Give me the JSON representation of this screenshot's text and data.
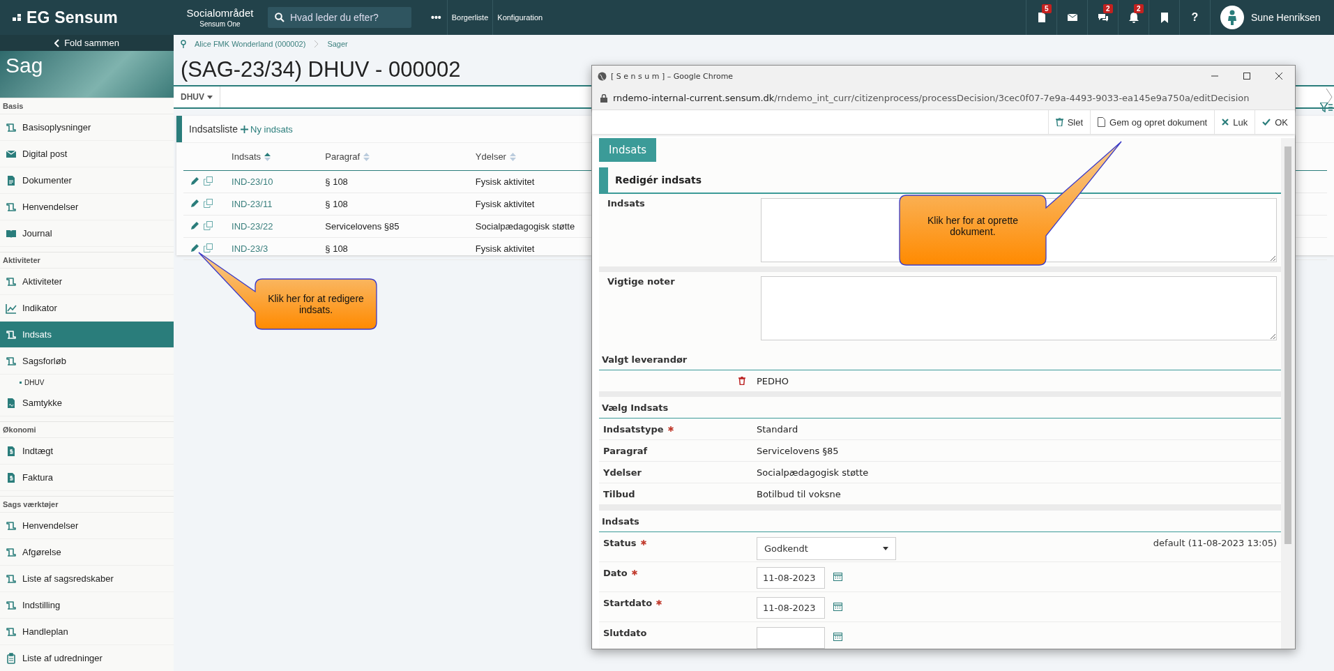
{
  "topbar": {
    "logo": "EG Sensum",
    "area": "Socialområdet",
    "product": "Sensum One",
    "search": {
      "placeholder": "Hvad leder du efter?"
    },
    "more": "•••",
    "links": [
      "Borgerliste",
      "Konfiguration"
    ],
    "icons": [
      {
        "kind": "document",
        "badge": "5"
      },
      {
        "kind": "mail"
      },
      {
        "kind": "chat",
        "badge": "2"
      },
      {
        "kind": "bell",
        "badge": "2"
      },
      {
        "kind": "bookmark"
      },
      {
        "kind": "help",
        "label": "?"
      }
    ],
    "user": "Sune Henriksen"
  },
  "sidebar": {
    "collapse": "Fold sammen",
    "title": "Sag",
    "sections": [
      {
        "heading": "Basis",
        "items": [
          {
            "label": "Basisoplysninger",
            "kind": "scroll",
            "selected": false
          },
          {
            "label": "Digital post",
            "kind": "mail",
            "selected": false
          },
          {
            "label": "Dokumenter",
            "kind": "document",
            "selected": false
          },
          {
            "label": "Henvendelser",
            "kind": "scroll",
            "selected": false
          },
          {
            "label": "Journal",
            "kind": "book",
            "selected": false
          }
        ]
      },
      {
        "heading": "Aktiviteter",
        "items": [
          {
            "label": "Aktiviteter",
            "kind": "scroll",
            "selected": false
          },
          {
            "label": "Indikator",
            "kind": "chart",
            "selected": false
          },
          {
            "label": "Indsats",
            "kind": "scroll",
            "selected": true
          },
          {
            "label": "Sagsforløb",
            "kind": "scroll",
            "selected": false,
            "children": [
              {
                "label": "DHUV",
                "selected": false
              }
            ]
          },
          {
            "label": "Samtykke",
            "kind": "signed",
            "selected": false
          }
        ]
      },
      {
        "heading": "Økonomi",
        "items": [
          {
            "label": "Indtægt",
            "kind": "money",
            "selected": false
          },
          {
            "label": "Faktura",
            "kind": "money",
            "selected": false
          }
        ]
      },
      {
        "heading": "Sags værktøjer",
        "items": [
          {
            "label": "Henvendelser",
            "kind": "scroll",
            "selected": false
          },
          {
            "label": "Afgørelse",
            "kind": "scroll",
            "selected": false
          },
          {
            "label": "Liste af sagsredskaber",
            "kind": "scroll",
            "selected": false
          },
          {
            "label": "Indstilling",
            "kind": "scroll",
            "selected": false
          },
          {
            "label": "Handleplan",
            "kind": "scroll",
            "selected": false
          },
          {
            "label": "Liste af udredninger",
            "kind": "clipboard",
            "selected": false
          }
        ]
      }
    ]
  },
  "main": {
    "breadcrumb": [
      "Alice FMK Wonderland (000002)",
      "Sager"
    ],
    "title": "(SAG-23/34) DHUV - 000002",
    "case_tab": {
      "label": "DHUV"
    },
    "panel": {
      "title": "Indsatsliste",
      "action": "Ny indsats",
      "columns": [
        {
          "label": "Indsats",
          "sorted": true
        },
        {
          "label": "Paragraf",
          "sorted": false
        },
        {
          "label": "Ydelser",
          "sorted": false
        }
      ],
      "rows": [
        [
          "IND-23/10",
          "§ 108",
          "Fysisk aktivitet"
        ],
        [
          "IND-23/11",
          "§ 108",
          "Fysisk aktivitet"
        ],
        [
          "IND-23/22",
          "Servicelovens §85",
          "Socialpædagogisk støtte"
        ],
        [
          "IND-23/3",
          "§ 108",
          "Fysisk aktivitet"
        ]
      ]
    }
  },
  "popup": {
    "window_title": "[ S e n s u m ] – Google Chrome",
    "url": {
      "host": "rndemo-internal-current.sensum.dk",
      "path": "/rndemo_int_curr/citizenprocess/processDecision/3cec0f07-7e9a-4493-9033-ea145e9a750a/editDecision"
    },
    "toolbar": [
      {
        "kind": "delete",
        "label": "Slet"
      },
      {
        "kind": "document",
        "label": "Gem og opret dokument"
      },
      {
        "kind": "close",
        "label": "Luk"
      },
      {
        "kind": "ok",
        "label": "OK"
      }
    ],
    "tab": "Indsats",
    "section_title": "Redigér indsats",
    "text_areas": [
      {
        "label": "Indsats"
      },
      {
        "label": "Vigtige noter"
      }
    ],
    "supplier": {
      "heading": "Valgt leverandør",
      "value": "PEDHO"
    },
    "choice": {
      "heading": "Vælg Indsats",
      "rows": [
        {
          "label": "Indsatstype",
          "required": true,
          "value": "Standard"
        },
        {
          "label": "Paragraf",
          "required": false,
          "value": "Servicelovens §85"
        },
        {
          "label": "Ydelser",
          "required": false,
          "value": "Socialpædagogisk støtte"
        },
        {
          "label": "Tilbud",
          "required": false,
          "value": "Botilbud til voksne"
        }
      ]
    },
    "status": {
      "heading": "Indsats",
      "rows": [
        {
          "kind": "select",
          "label": "Status",
          "required": true,
          "value": "Godkendt",
          "note": "default (11-08-2023 13:05)"
        },
        {
          "kind": "date",
          "label": "Dato",
          "required": true,
          "value": "11-08-2023"
        },
        {
          "kind": "date",
          "label": "Startdato",
          "required": true,
          "value": "11-08-2023"
        },
        {
          "kind": "date",
          "label": "Slutdato",
          "required": false
        }
      ]
    }
  },
  "callouts": [
    {
      "text": "Klik her for at redigere indsats."
    },
    {
      "text": "Klik her for at oprette dokument."
    }
  ]
}
